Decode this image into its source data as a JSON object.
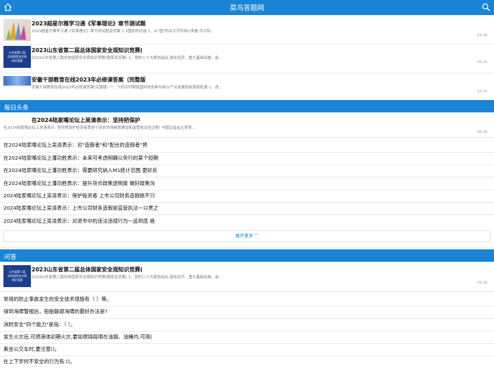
{
  "header": {
    "title": "菜鸟答题网"
  },
  "top_items": [
    {
      "title": "2023超星尔雅学习通《军事理论》章节测试题",
      "desc": "2023超星尔雅学习通《军事理论》章节测试题及答案 1.1国防的内涵 1、从\"国\"的古文字形体()来看,可以知...",
      "date": "03-19"
    },
    {
      "title": "2023山东省第二届总体国家安全观知识竞赛(",
      "desc": "2023山东省第二届总体国家安全观知识竞赛(题库及答案) 1、党的二十大报告指出,强化经济、重大基础设施、金...",
      "date": "03-10"
    },
    {
      "title": "安徽干部教育在线2023年必修课答案（完整版",
      "desc": "安徽干部教育在线2023年必修课答案(完整版) 一、十四五时期我国科技创新与新兴产业发展的前景和机遇 1、改...",
      "date": "03-10"
    }
  ],
  "daily": {
    "section": "每日头条",
    "lead": {
      "title": "在2024陆家嘴论坛上吴清表示：坚持把保护",
      "desc": "在2024陆家嘴论坛上吴清表示: 坚持把保护投资者贯穿于资本市场制度建设和监管执法全过程! 中国证监会主席吴...",
      "date": "06-19"
    },
    "lines": [
      "在2024陆家嘴论坛上吴清表示：对\"造假者\"和\"配合的造假者\"将",
      "在2024陆家嘴论坛上潘功胜表示：未来可考虑明确以央行的某个短期",
      "在2024陆家嘴论坛上潘功胜表示：需要研究纳入M1统计范围 更好反",
      "在2024陆家嘴论坛上潘功胜表示：提升货币政策透明度 做好政策沟",
      "2024陆家嘴论坛上吴清表示：保护投资者 上市公司财务造假绝不只",
      "2024陆家嘴论坛上吴清表示：上市公司财务造假是监管执法一以贯之",
      "2024陆家嘴论坛上吴清表示：对退市中的违法违规行为一追到底 绝"
    ],
    "more_label": "展开更多"
  },
  "qa": {
    "section": "问答",
    "lead": {
      "title": "2023山东省第二届总体国家安全观知识竞赛(",
      "desc": "2023山东省第二届总体国家安全观知识竞赛(题库及答案) 1、党的二十大报告指出,强化经济、重大基础设施、金...",
      "date": "03-10"
    },
    "lines": [
      "常用的防止事故发生的安全技术措施有（ ）等。",
      "得到海啸警报后，船舶躲避海啸的最好办法是?",
      "消防安全\"四个能力\"是指：（ ）。",
      "发生火灾后,可燃液体初期火灾,要如燃烧局限在油锅、油桶内,可用(",
      "乘坐公交车时,要注意()。",
      "在上下学时不安全的行为有:()。"
    ]
  },
  "thumb_text": [
    "山东省第二届",
    "总体国家安全观",
    "知识竞赛"
  ],
  "colors": {
    "header": "#1a84d6",
    "accent": "#1a84d6"
  }
}
